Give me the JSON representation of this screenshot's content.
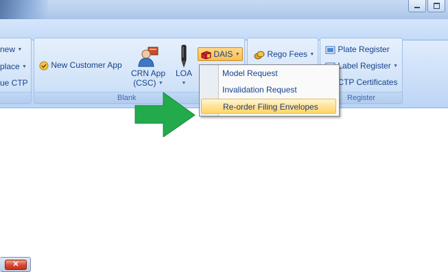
{
  "ribbon": {
    "left_group": {
      "items": [
        "new",
        "place",
        "ue CTP"
      ]
    },
    "blank_group": {
      "label": "Blank",
      "new_customer_app": "New Customer App",
      "crn_app_line1": "CRN App",
      "crn_app_line2": "(CSC)",
      "loa": "LOA",
      "dais": "DAIS"
    },
    "rego_group": {
      "rego_fees": "Rego Fees"
    },
    "register_group": {
      "label": "Register",
      "plate_register": "Plate Register",
      "label_register": "Label Register",
      "ctp_certificates": "CTP Certificates"
    }
  },
  "dais_menu": {
    "items": [
      "Model Request",
      "Invalidation Request",
      "Re-order Filing Envelopes"
    ],
    "highlighted_index": 2
  },
  "annotation": {
    "color": "#22aa4c"
  },
  "colors": {
    "ribbon_text": "#15428b",
    "menu_highlight": "#ffe29a"
  }
}
